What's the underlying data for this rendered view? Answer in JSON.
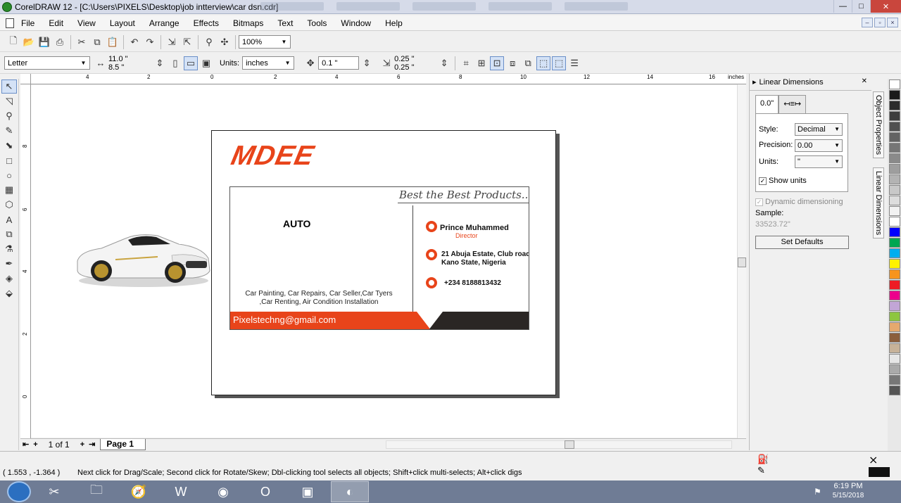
{
  "window": {
    "title": "CorelDRAW 12 - [C:\\Users\\PIXELS\\Desktop\\job intterview\\car dsn.cdr]",
    "min_label": "—",
    "max_label": "□",
    "close_label": "✕"
  },
  "menu": [
    "File",
    "Edit",
    "View",
    "Layout",
    "Arrange",
    "Effects",
    "Bitmaps",
    "Text",
    "Tools",
    "Window",
    "Help"
  ],
  "toolbar": {
    "zoom": "100%"
  },
  "propertybar": {
    "paper_size": "Letter",
    "width": "11.0 \"",
    "height": "8.5 \"",
    "units_label": "Units:",
    "units_value": "inches",
    "nudge": "0.1 \"",
    "dup_x": "0.25 \"",
    "dup_y": "0.25 \""
  },
  "ruler": {
    "unit": "inches",
    "h_labels": [
      "4",
      "2",
      "0",
      "2",
      "4",
      "6",
      "8",
      "10",
      "12",
      "14",
      "16"
    ],
    "v_labels": [
      "8",
      "6",
      "4",
      "2",
      "0"
    ]
  },
  "card": {
    "logo": "MDEE",
    "tagline": "Best the Best Products.....",
    "brand": "AUTO",
    "services_line1": "Car Painting, Car Repairs, Car Seller,Car Tyers",
    "services_line2": ",Car Renting, Air Condition Installation",
    "name": "Prince Muhammed",
    "role": "Director",
    "address_line1": "21 Abuja Estate, Club road,",
    "address_line2": "Kano State, Nigeria",
    "phone": "+234 8188813432",
    "email": "Pixelstechng@gmail.com",
    "colors": {
      "accent": "#e8441a",
      "dark": "#2a2624"
    }
  },
  "pages": {
    "count": "1 of 1",
    "tab": "Page 1"
  },
  "docker": {
    "title": "Linear Dimensions",
    "tab_value": "0.0\"",
    "style_label": "Style:",
    "style_value": "Decimal",
    "precision_label": "Precision:",
    "precision_value": "0.00",
    "units_label": "Units:",
    "units_value": "\"",
    "show_units": "Show units",
    "dynamic": "Dynamic dimensioning",
    "sample_label": "Sample:",
    "sample_value": "33523.72\"",
    "set_defaults": "Set Defaults",
    "vtab_1": "Object Properties",
    "vtab_2": "Linear Dimensions"
  },
  "palette": [
    "#ffffff",
    "#1a1a1a",
    "#2b2b2b",
    "#3d3d3d",
    "#505050",
    "#636363",
    "#767676",
    "#8a8a8a",
    "#9e9e9e",
    "#b3b3b3",
    "#c8c8c8",
    "#dddddd",
    "#f2f2f2",
    "#ffffff",
    "#0000ff",
    "#00a651",
    "#00aeef",
    "#fff200",
    "#f7941d",
    "#ed1c24",
    "#ec008c",
    "#c2a6d6",
    "#8dc63f",
    "#e5a96e",
    "#8b5e3c",
    "#c7b299",
    "#e6e6e6",
    "#aaaaaa",
    "#777777",
    "#555555"
  ],
  "status": {
    "coords": "( 1.553 , -1.364 )",
    "hint": "Next click for Drag/Scale; Second click for Rotate/Skew; Dbl-clicking tool selects all objects; Shift+click multi-selects; Alt+click digs"
  },
  "taskbar": {
    "time": "6:19 PM",
    "date": "5/15/2018"
  }
}
